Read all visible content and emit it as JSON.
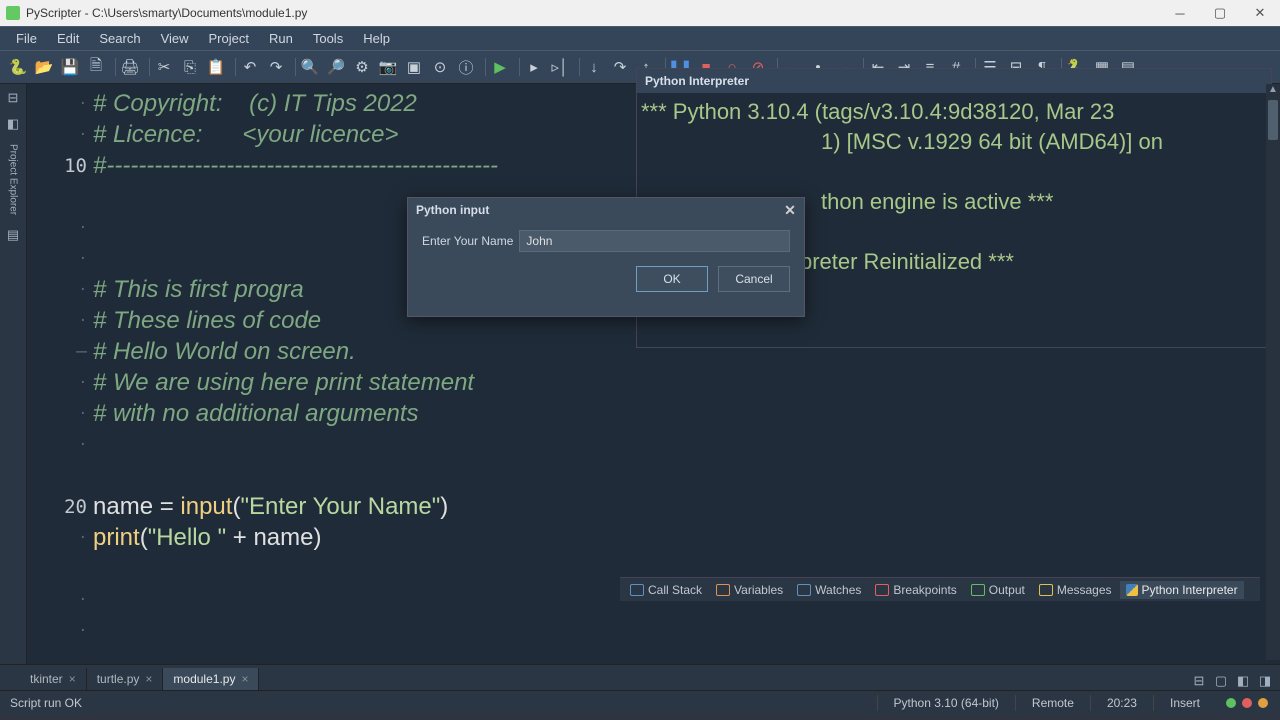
{
  "titlebar": {
    "text": "PyScripter - C:\\Users\\smarty\\Documents\\module1.py"
  },
  "menu": [
    "File",
    "Edit",
    "Search",
    "View",
    "Project",
    "Run",
    "Tools",
    "Help"
  ],
  "sidebar_label": "Project Explorer",
  "gutter": [
    {
      "t": "dot"
    },
    {
      "t": "dot"
    },
    {
      "t": "num",
      "v": "10"
    },
    {
      "t": ""
    },
    {
      "t": "dot"
    },
    {
      "t": "dot"
    },
    {
      "t": "dot"
    },
    {
      "t": "dot"
    },
    {
      "t": "dash"
    },
    {
      "t": "dot"
    },
    {
      "t": "dot"
    },
    {
      "t": "dot"
    },
    {
      "t": ""
    },
    {
      "t": "num",
      "v": "20"
    },
    {
      "t": "dot"
    },
    {
      "t": ""
    },
    {
      "t": "dot"
    },
    {
      "t": "dot"
    }
  ],
  "code": {
    "l1": "# Copyright:    (c) IT Tips 2022",
    "l2": "# Licence:      <your licence>",
    "l3": "#-------------------------------------------------",
    "l4": "",
    "l5": "",
    "l6": "",
    "l7": "# This is first progra",
    "l8": "# These lines of code ",
    "l9": "# Hello World on screen.",
    "l10": "# We are using here print statement",
    "l11": "# with no additional arguments",
    "l12": "",
    "l13": "",
    "name_lhs": "name",
    "eq": " = ",
    "input_fn": "input",
    "input_arg": "\"Enter Your Name\"",
    "print_fn": "print",
    "print_arg1": "\"Hello \"",
    "plus": " + ",
    "print_arg2": "name"
  },
  "interpreter": {
    "title": "Python Interpreter",
    "l1": "*** Python 3.10.4 (tags/v3.10.4:9d38120, Mar 23",
    "l2": "1) [MSC v.1929 64 bit (AMD64)] on ",
    "l3": "thon engine is active ***",
    "l4": ">>>",
    "l5": "*** Remote Interpreter Reinitialized ***"
  },
  "dialog": {
    "title": "Python input",
    "label": "Enter Your Name",
    "value": "John",
    "ok": "OK",
    "cancel": "Cancel"
  },
  "bottom_tabs": [
    "Call Stack",
    "Variables",
    "Watches",
    "Breakpoints",
    "Output",
    "Messages",
    "Python Interpreter"
  ],
  "file_tabs": [
    {
      "name": "tkinter",
      "active": false
    },
    {
      "name": "turtle.py",
      "active": false
    },
    {
      "name": "module1.py",
      "active": true
    }
  ],
  "status": {
    "msg": "Script run OK",
    "python": "Python 3.10 (64-bit)",
    "mode": "Remote",
    "time": "20:23",
    "ins": "Insert"
  }
}
